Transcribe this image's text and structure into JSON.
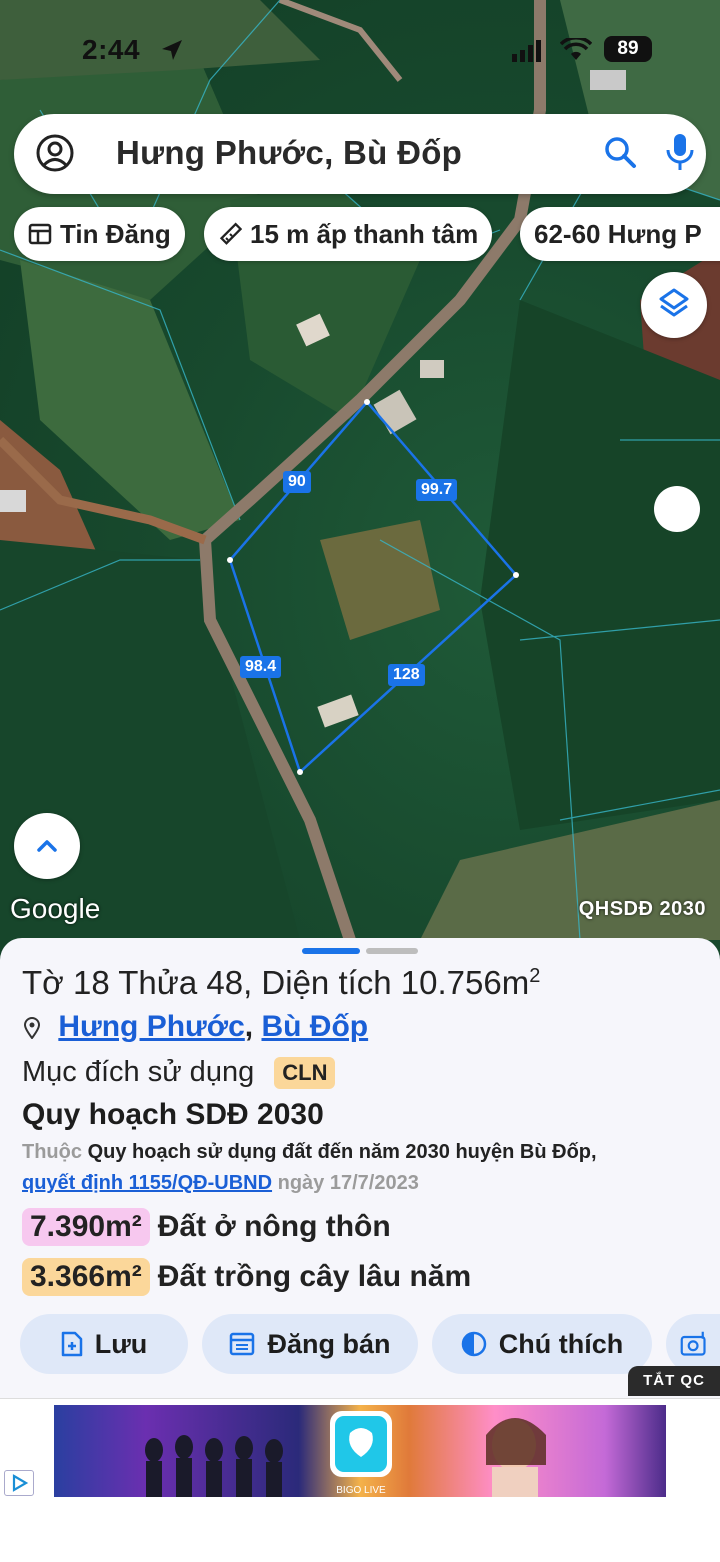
{
  "status": {
    "time": "2:44",
    "battery": "89"
  },
  "search": {
    "query": "Hưng Phước, Bù Đốp"
  },
  "chips": [
    {
      "label": "Tin Đăng",
      "icon": "news-icon"
    },
    {
      "label": "15 m ấp thanh tâm",
      "icon": "ruler-icon"
    },
    {
      "label": "62-60 Hưng P"
    }
  ],
  "map": {
    "dimensions": [
      "90",
      "99.7",
      "98.4",
      "128"
    ],
    "google_logo": "Google",
    "layer_label": "QHSDĐ 2030"
  },
  "parcel": {
    "title_main": "Tờ 18 Thửa 48, Diện tích 10.756m",
    "title_sup": "2",
    "location_1": "Hưng Phước",
    "location_sep": ",",
    "location_2": "Bù Đốp",
    "purpose_label": "Mục đích sử dụng",
    "purpose_code": "CLN",
    "plan_title": "Quy hoạch SDĐ 2030",
    "plan_prefix": "Thuộc",
    "plan_desc": "Quy hoạch sử dụng đất đến năm 2030 huyện Bù Đốp,",
    "plan_link": "quyết định 1155/QĐ-UBND",
    "plan_date": "ngày 17/7/2023",
    "areas": [
      {
        "value": "7.390m²",
        "label": "Đất ở nông thôn",
        "color": "#f7c8ef"
      },
      {
        "value": "3.366m²",
        "label": "Đất trồng cây lâu năm",
        "color": "#fbd79a"
      }
    ]
  },
  "actions": {
    "save": "Lưu",
    "post_sale": "Đăng bán",
    "legend": "Chú thích"
  },
  "ad": {
    "hide_label": "TẮT QC",
    "app_name": "BIGO LIVE"
  },
  "colors": {
    "accent": "#1a73e8",
    "button_bg": "#dfe8f8"
  }
}
